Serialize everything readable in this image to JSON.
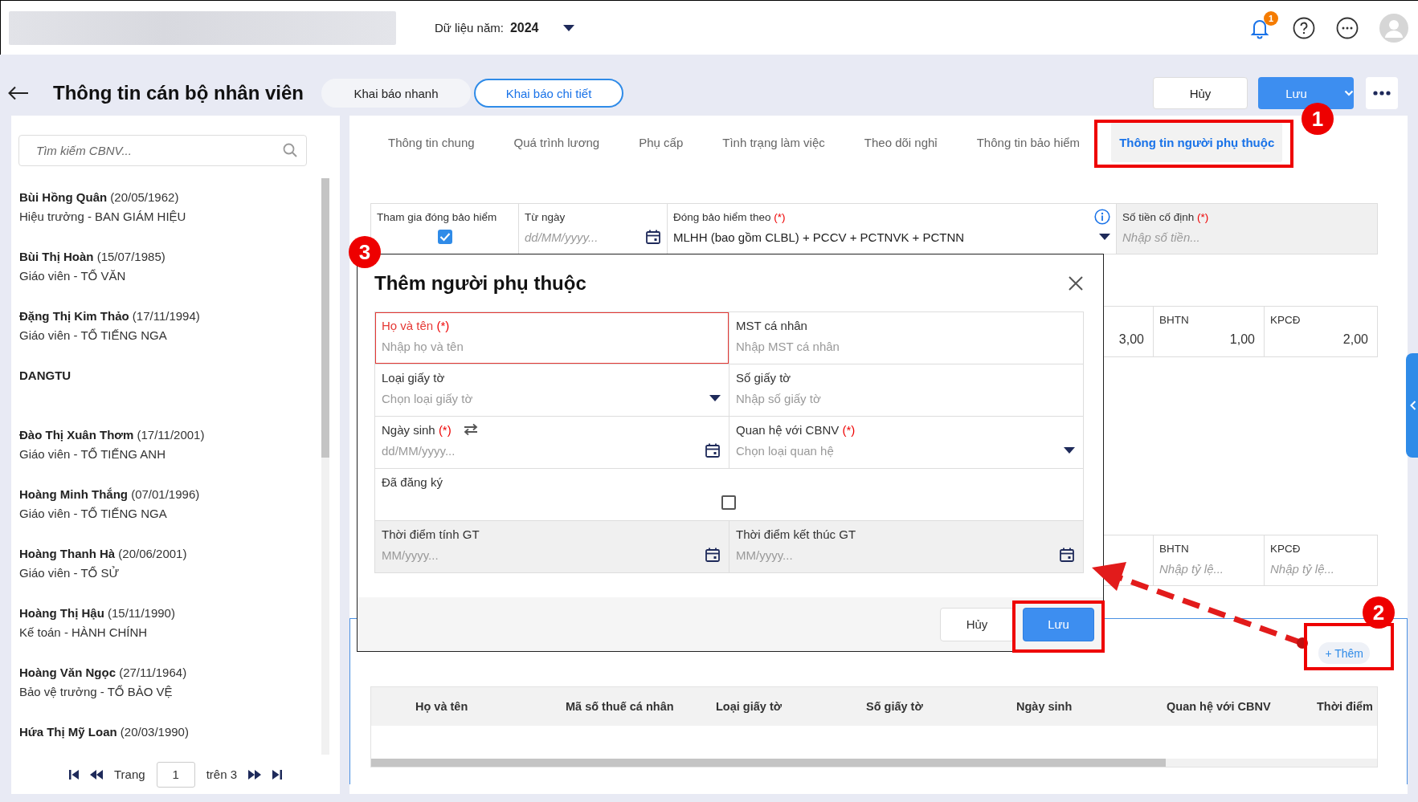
{
  "top_bar": {
    "year_label": "Dữ liệu năm:",
    "year": "2024",
    "notification_count": "1"
  },
  "header": {
    "title": "Thông tin cán bộ nhân viên",
    "modes": [
      {
        "label": "Khai báo nhanh",
        "selected": false
      },
      {
        "label": "Khai báo chi tiết",
        "selected": true
      }
    ],
    "cancel_button": "Hủy",
    "save_button": "Lưu"
  },
  "sidebar": {
    "search_placeholder": "Tìm kiếm CBNV...",
    "employees": [
      {
        "name": "Bùi Hồng Quân",
        "birth_date": "(20/05/1962)",
        "position": "Hiệu trưởng - BAN GIÁM HIỆU"
      },
      {
        "name": "Bùi Thị Hoàn",
        "birth_date": "(15/07/1985)",
        "position": "Giáo viên - TỔ VĂN"
      },
      {
        "name": "Đặng Thị Kim Thảo",
        "birth_date": "(17/11/1994)",
        "position": "Giáo viên - TỔ TIẾNG NGA"
      },
      {
        "name": "DANGTU"
      },
      {
        "name": "Đào Thị Xuân Thơm",
        "birth_date": "(17/11/2001)",
        "position": "Giáo viên - TỔ TIẾNG ANH"
      },
      {
        "name": "Hoàng Minh Thắng",
        "birth_date": "(07/01/1996)",
        "position": "Giáo viên - TỔ TIẾNG NGA"
      },
      {
        "name": "Hoàng Thanh Hà",
        "birth_date": "(20/06/2001)",
        "position": "Giáo viên - TỔ SỬ"
      },
      {
        "name": "Hoàng Thị Hậu",
        "birth_date": "(15/11/1990)",
        "position": "Kế toán - HÀNH CHÍNH"
      },
      {
        "name": "Hoàng Văn Ngọc",
        "birth_date": "(27/11/1964)",
        "position": "Bảo vệ trưởng - TỔ BẢO VỆ"
      },
      {
        "name": "Hứa Thị Mỹ Loan",
        "birth_date": "(20/03/1990)"
      }
    ],
    "pagination": {
      "label": "Trang",
      "page": "1",
      "total": "trên 3"
    }
  },
  "tabs": [
    {
      "label": "Thông tin chung",
      "selected": false
    },
    {
      "label": "Quá trình lương",
      "selected": false
    },
    {
      "label": "Phụ cấp",
      "selected": false
    },
    {
      "label": "Tình trạng làm việc",
      "selected": false
    },
    {
      "label": "Theo dõi nghỉ",
      "selected": false
    },
    {
      "label": "Thông tin bảo hiểm",
      "selected": false
    },
    {
      "label": "Thông tin người phụ thuộc",
      "selected": true
    }
  ],
  "insurance_fields": [
    {
      "kind": "checkbox",
      "label": "Tham gia đóng bảo hiểm",
      "checked": true,
      "disabled": false
    },
    {
      "kind": "date",
      "label": "Từ ngày",
      "placeholder": "dd/MM/yyyy...",
      "disabled": false
    },
    {
      "kind": "select",
      "label": "Đóng bảo hiểm theo",
      "required_mark": "(*)",
      "value": "MLHH (bao gồm CLBL) + PCCV + PCTNVK + PCTNN",
      "disabled": false
    },
    {
      "kind": "text",
      "label": "Số tiền cố định",
      "required_mark": "(*)",
      "placeholder": "Nhập số tiền...",
      "disabled": true
    }
  ],
  "rates": [
    {
      "value": "3,00"
    },
    {
      "label": "BHTN",
      "value": "1,00"
    },
    {
      "label": "KPCĐ",
      "value": "2,00"
    }
  ],
  "rate_inputs": [
    {
      "label": "BHTN",
      "placeholder": "Nhập tỷ lệ..."
    },
    {
      "label": "KPCĐ",
      "placeholder": "Nhập tỷ lệ..."
    }
  ],
  "dependents": {
    "add_button": "+ Thêm",
    "columns": [
      "Họ và tên",
      "Mã số thuế cá nhân",
      "Loại giấy tờ",
      "Số giấy tờ",
      "Ngày sinh",
      "Quan hệ với CBNV",
      "Thời điểm"
    ]
  },
  "modal": {
    "title": "Thêm người phụ thuộc",
    "fields": [
      {
        "kind": "text",
        "label": "Họ và tên",
        "required_mark": "(*)",
        "placeholder": "Nhập họ và tên",
        "invalid": true,
        "disabled": false
      },
      {
        "kind": "text",
        "label": "MST cá nhân",
        "placeholder": "Nhập MST cá nhân",
        "invalid": false,
        "disabled": false
      },
      {
        "kind": "select",
        "label": "Loại giấy tờ",
        "placeholder": "Chọn loại giấy tờ",
        "invalid": false,
        "disabled": false
      },
      {
        "kind": "text",
        "label": "Số giấy tờ",
        "placeholder": "Nhập số giấy tờ",
        "invalid": false,
        "disabled": false
      },
      {
        "kind": "date_switch",
        "label": "Ngày sinh",
        "required_mark": "(*)",
        "placeholder": "dd/MM/yyyy...",
        "invalid": false,
        "disabled": false
      },
      {
        "kind": "select",
        "label": "Quan hệ với CBNV",
        "required_mark": "(*)",
        "placeholder": "Chọn loại quan hệ",
        "invalid": false,
        "disabled": false
      },
      {
        "kind": "checkbox",
        "label": "Đã đăng ký",
        "checked": false,
        "invalid": false,
        "disabled": false
      },
      {
        "kind": "date",
        "label": "Thời điểm tính GT",
        "placeholder": "MM/yyyy...",
        "invalid": false,
        "disabled": true
      },
      {
        "kind": "date",
        "label": "Thời điểm kết thúc GT",
        "placeholder": "MM/yyyy...",
        "invalid": false,
        "disabled": true
      }
    ],
    "cancel_button": "Hủy",
    "save_button": "Lưu"
  },
  "annotations": [
    {
      "label": "1"
    },
    {
      "label": "2"
    },
    {
      "label": "3"
    }
  ]
}
